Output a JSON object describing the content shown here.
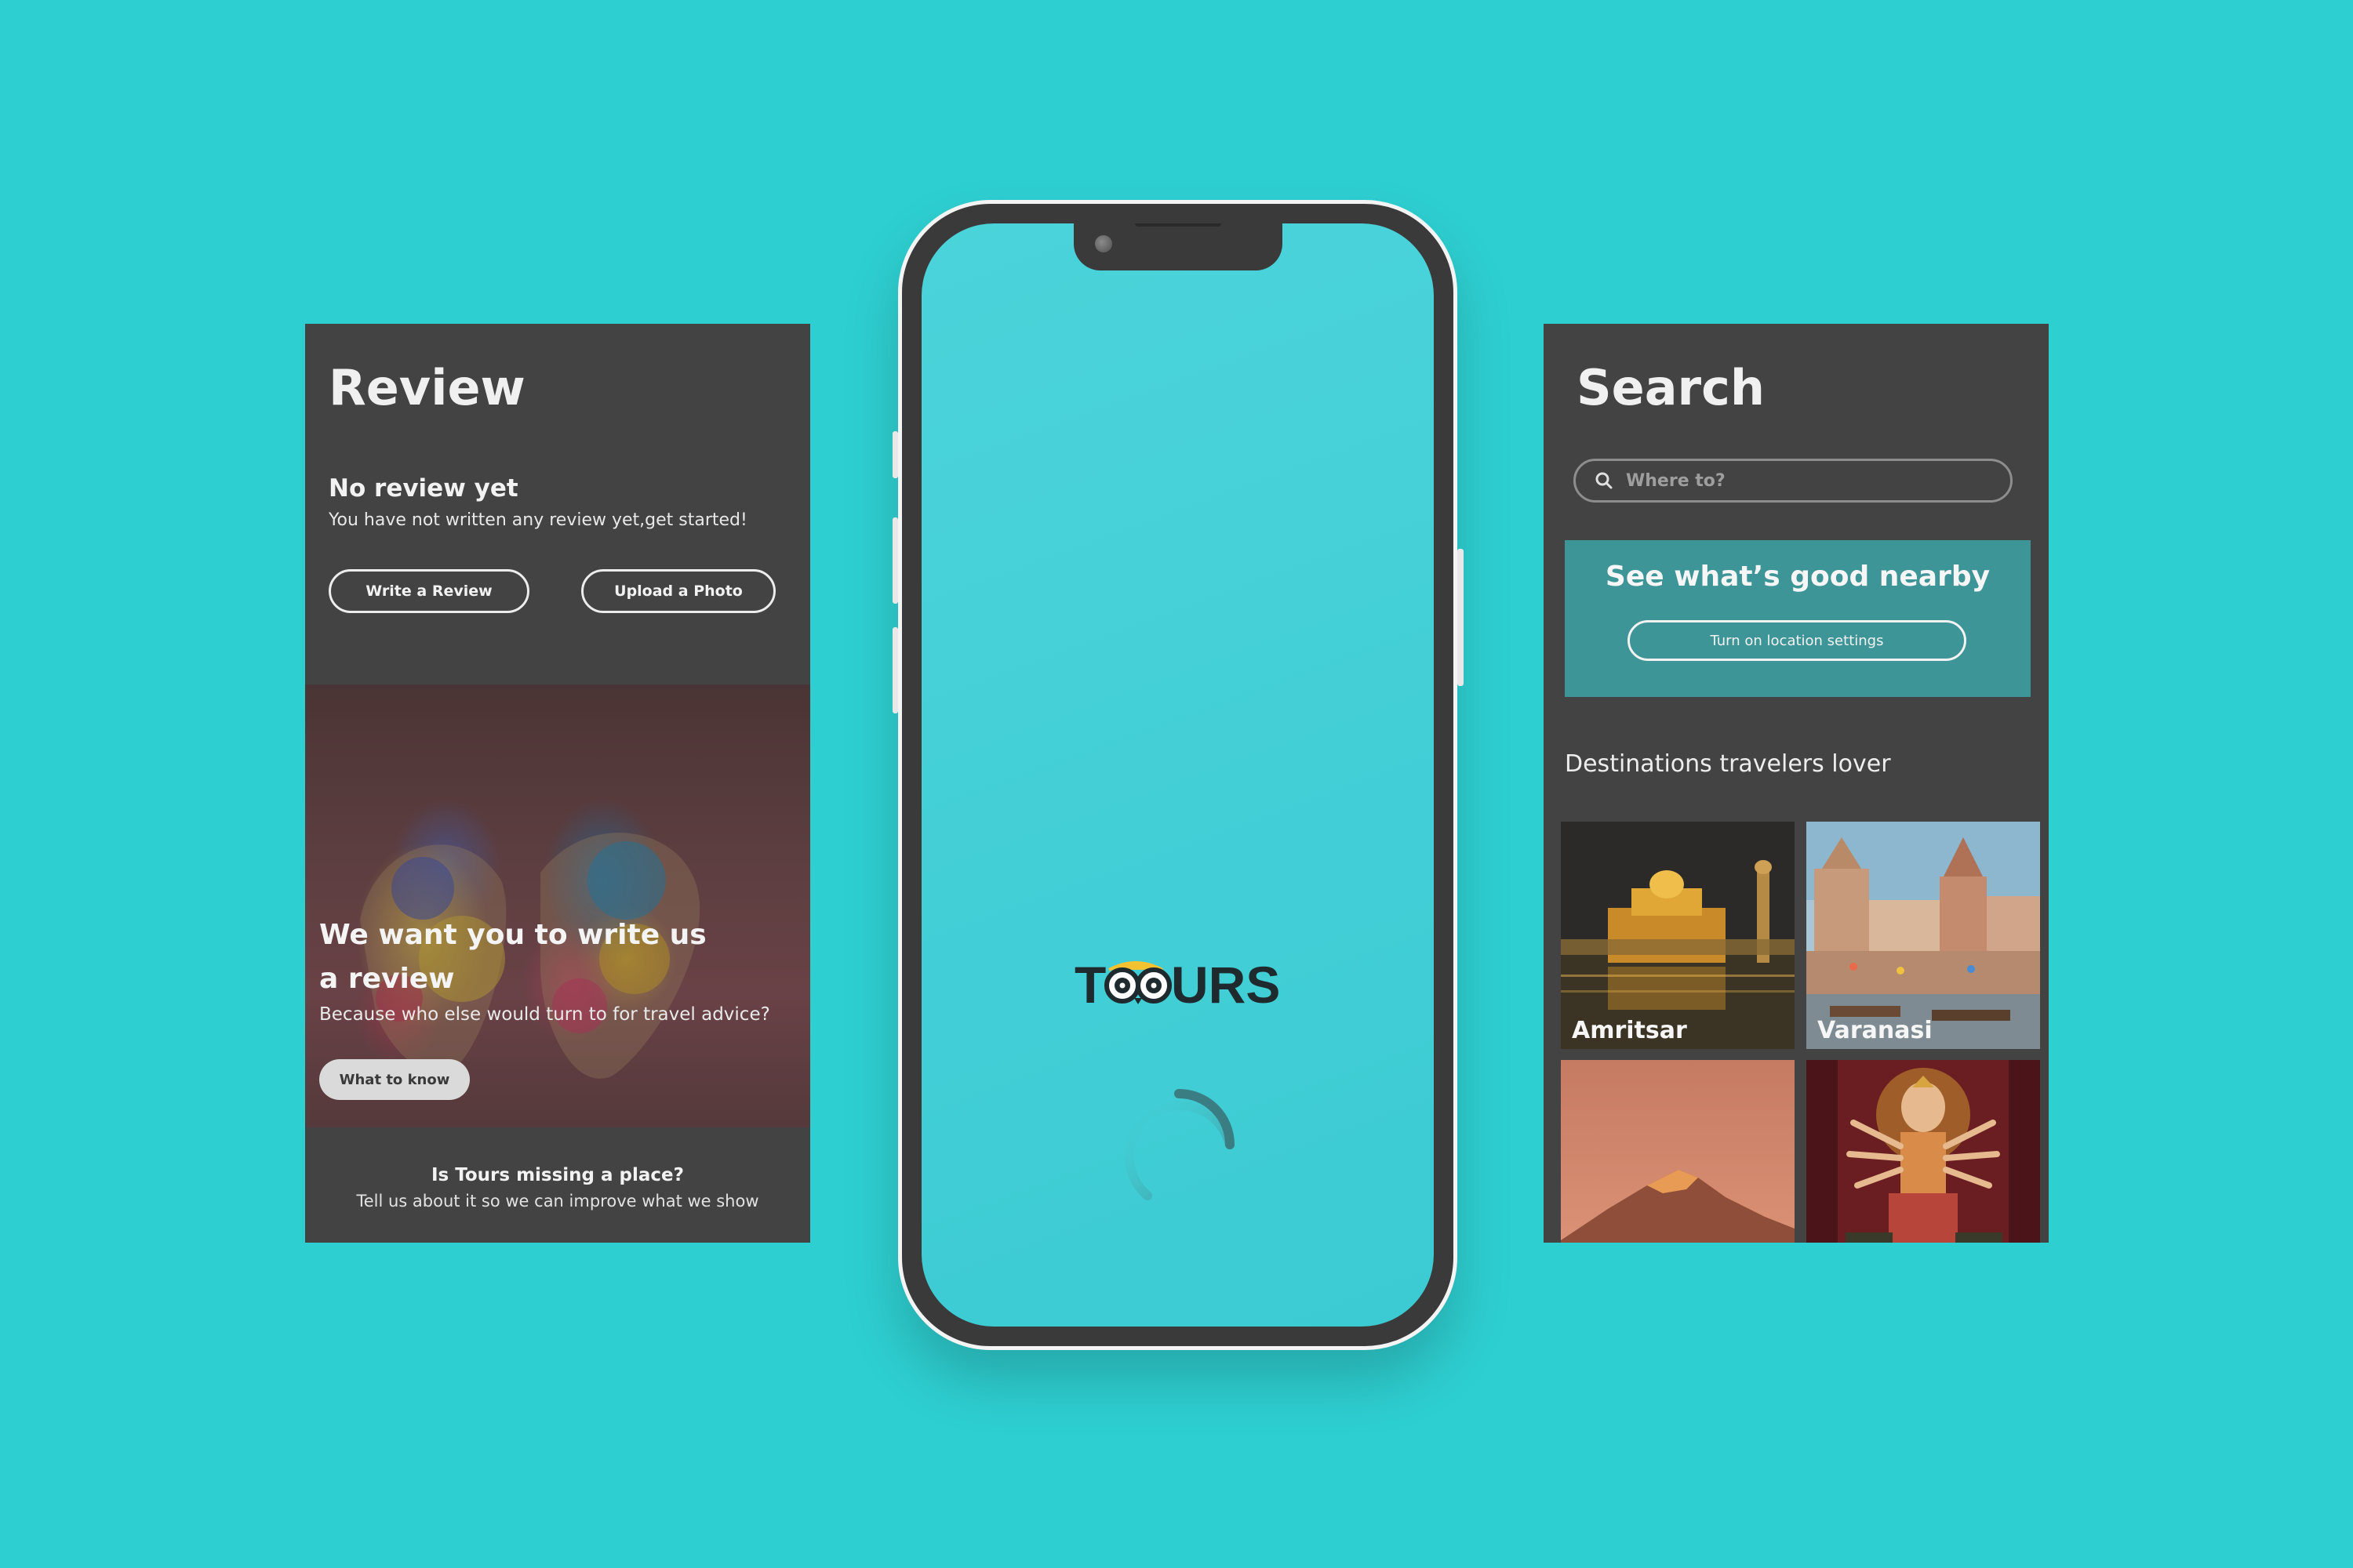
{
  "colors": {
    "background": "#2ECFD1",
    "card": "#434343",
    "accent_teal": "#3E9597",
    "phone_screen": "#41CFD6"
  },
  "review": {
    "title": "Review",
    "empty_title": "No review yet",
    "empty_sub": "You have not written any review yet,get started!",
    "write_review_label": "Write a Review",
    "upload_photo_label": "Upload a Photo",
    "hero_title_line1": "We want you to write us",
    "hero_title_line2": "a review",
    "hero_sub": "Because who else would turn to for travel advice?",
    "what_to_know_label": "What to know",
    "missing_title": "Is Tours missing a place?",
    "missing_sub": "Tell us about it so we can improve what we show"
  },
  "splash": {
    "logo_text": "TOOURS"
  },
  "search": {
    "title": "Search",
    "placeholder": "Where to?",
    "nearby_title": "See what’s good nearby",
    "location_button": "Turn on location settings",
    "destinations_title": "Destinations travelers lover",
    "destinations": [
      {
        "name": "Amritsar"
      },
      {
        "name": "Varanasi"
      },
      {
        "name": ""
      },
      {
        "name": ""
      }
    ]
  }
}
